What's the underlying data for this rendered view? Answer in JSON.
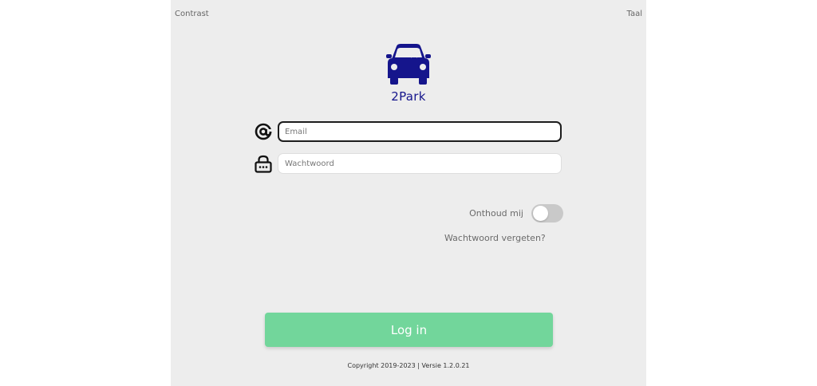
{
  "header": {
    "contrast_label": "Contrast",
    "language_label": "Taal"
  },
  "logo": {
    "icon": "car-icon",
    "brand_name": "2Park",
    "brand_color": "#15158c"
  },
  "login_form": {
    "email": {
      "icon": "at-sign-icon",
      "placeholder": "Email",
      "value": ""
    },
    "password": {
      "icon": "lock-icon",
      "placeholder": "Wachtwoord",
      "value": ""
    },
    "remember_me": {
      "label": "Onthoud mij",
      "checked": false
    },
    "forgot_password_label": "Wachtwoord vergeten?",
    "submit_label": "Log in",
    "submit_color": "#72d69b"
  },
  "footer": {
    "copyright": "Copyright 2019-2023 | Versie 1.2.0.21"
  }
}
